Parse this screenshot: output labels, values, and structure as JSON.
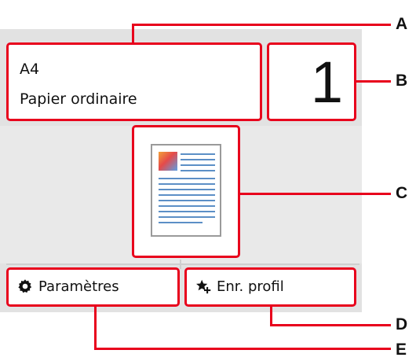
{
  "paper": {
    "size": "A4",
    "type": "Papier ordinaire"
  },
  "copies": {
    "value": "1"
  },
  "buttons": {
    "settings_label": "Paramètres",
    "profile_label": "Enr. profil"
  },
  "callouts": [
    "A",
    "B",
    "C",
    "D",
    "E"
  ],
  "colors": {
    "accent": "#e8001c"
  },
  "icons": {
    "settings": "gear-icon",
    "profile": "star-plus-icon"
  }
}
